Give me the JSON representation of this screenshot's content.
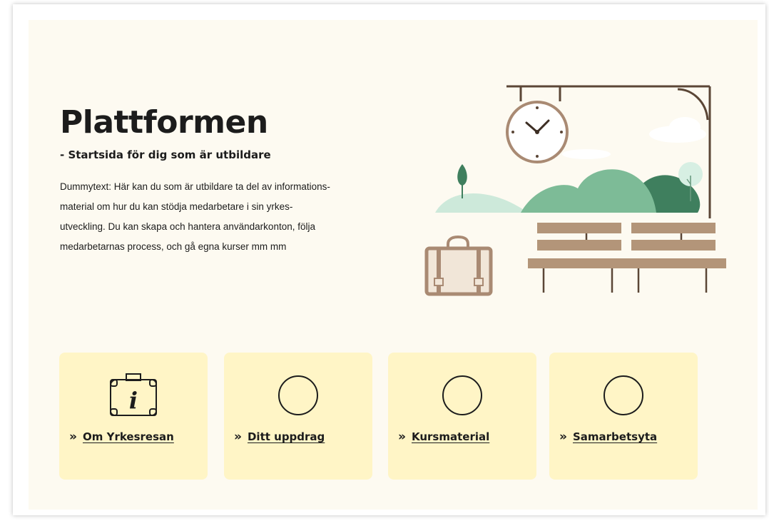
{
  "hero": {
    "title": "Plattformen",
    "subtitle": "- Startsida för dig som är utbildare",
    "body": "Dummytext: Här kan du som är utbildare ta del av informations-material om  hur du kan stödja medarbetare i sin yrkes-utveckling. Du kan skapa och hantera användarkonton, följa medarbetarnas process,  och gå egna kurser mm mm",
    "body_lines": [
      "Dummytext: Här kan du som är utbildare ta del av informations-",
      "material om  hur du kan stödja medarbetare i sin yrkes-",
      "utveckling. Du kan skapa och hantera användarkonton, följa",
      "medarbetarnas process,  och gå egna kurser mm mm"
    ]
  },
  "illustration": {
    "elements": [
      "clock-icon",
      "suitcase-icon",
      "bench-icon",
      "hills",
      "tree-icon",
      "cloud-icon"
    ]
  },
  "cards": [
    {
      "label": "Om Yrkesresan",
      "chevron": "»",
      "icon": "info-suitcase-icon"
    },
    {
      "label": "Ditt uppdrag",
      "chevron": "»",
      "icon": "circle-icon"
    },
    {
      "label": "Kursmaterial",
      "chevron": "»",
      "icon": "circle-icon"
    },
    {
      "label": "Samarbetsyta",
      "chevron": "»",
      "icon": "circle-icon"
    }
  ],
  "colors": {
    "page_background": "#fdfaf1",
    "card_background": "#fff5c6",
    "text": "#1c1c1c",
    "brown": "#a98a73",
    "bench_brown": "#b39579",
    "green_light": "#cde9da",
    "green_mid": "#7dbb97",
    "green_dark": "#3f7f5e"
  }
}
